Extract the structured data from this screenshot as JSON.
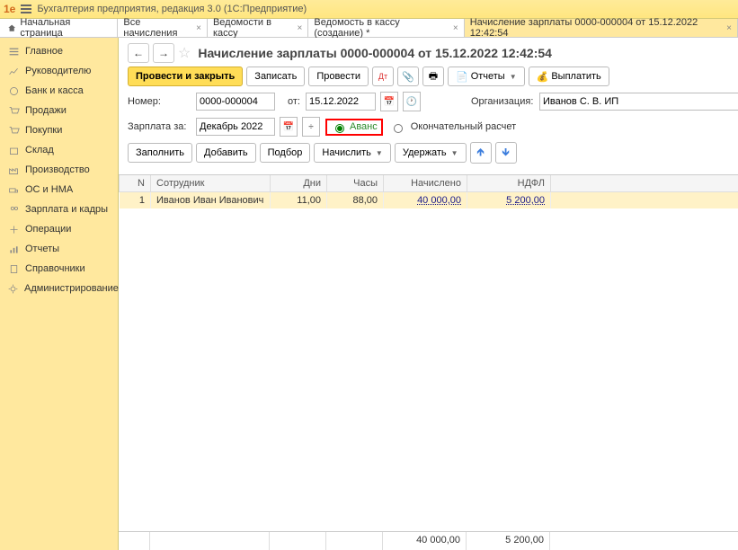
{
  "app": {
    "title": "Бухгалтерия предприятия, редакция 3.0  (1С:Предприятие)"
  },
  "tabs": {
    "home": "Начальная страница",
    "items": [
      {
        "label": "Все начисления"
      },
      {
        "label": "Ведомости в кассу"
      },
      {
        "label": "Ведомость в кассу (создание) *"
      },
      {
        "label": "Начисление зарплаты 0000-000004 от 15.12.2022 12:42:54",
        "active": true
      }
    ]
  },
  "sidebar": [
    "Главное",
    "Руководителю",
    "Банк и касса",
    "Продажи",
    "Покупки",
    "Склад",
    "Производство",
    "ОС и НМА",
    "Зарплата и кадры",
    "Операции",
    "Отчеты",
    "Справочники",
    "Администрирование"
  ],
  "page": {
    "title": "Начисление зарплаты 0000-000004 от 15.12.2022 12:42:54",
    "toolbar": {
      "post_close": "Провести и закрыть",
      "save": "Записать",
      "post": "Провести",
      "reports": "Отчеты",
      "pay": "Выплатить"
    },
    "fields": {
      "number_label": "Номер:",
      "number": "0000-000004",
      "date_label": "от:",
      "date": "15.12.2022",
      "org_label": "Организация:",
      "org": "Иванов С. В. ИП",
      "period_label": "Зарплата за:",
      "period": "Декабрь 2022",
      "radio_advance": "Аванс",
      "radio_final": "Окончательный расчет"
    },
    "toolbar2": {
      "fill": "Заполнить",
      "add": "Добавить",
      "pick": "Подбор",
      "calc": "Начислить",
      "hold": "Удержать"
    },
    "table": {
      "headers": {
        "n": "N",
        "emp": "Сотрудник",
        "days": "Дни",
        "hours": "Часы",
        "accrued": "Начислено",
        "ndfl": "НДФЛ"
      },
      "rows": [
        {
          "n": "1",
          "emp": "Иванов Иван Иванович",
          "days": "11,00",
          "hours": "88,00",
          "accrued": "40 000,00",
          "ndfl": "5 200,00"
        }
      ],
      "totals": {
        "accrued": "40 000,00",
        "ndfl": "5 200,00"
      }
    }
  }
}
